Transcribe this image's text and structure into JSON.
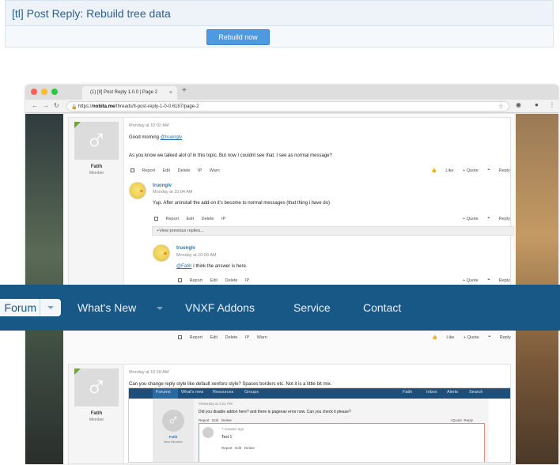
{
  "admin": {
    "title": "[tl] Post Reply: Rebuild tree data",
    "button": "Rebuild now"
  },
  "browser": {
    "tab_title": "(1) [tl] Post Reply 1.0.0 | Page 2",
    "tab_close": "×",
    "new_tab": "+",
    "url_prefix": "https://",
    "url_host": "nobita.me",
    "url_path": "/threads/tl-post-reply-1-0-0.6187/page-2"
  },
  "post1": {
    "author": "Fatih",
    "role": "Member",
    "date": "Monday at 10:02 AM",
    "line1_pre": "Good morning ",
    "line1_mention": "@truonglv",
    "line2": "As you know we talked alot of in this topic. But now I couldnt see that. I see as normal message?",
    "actions": [
      "Report",
      "Edit",
      "Delete",
      "IP",
      "Warn"
    ],
    "right_actions": [
      "Like",
      "+ Quote",
      "Reply"
    ]
  },
  "reply1": {
    "author": "truonglv",
    "date": "Monday at 10:04 AM",
    "text": "Yup. After uninstall the add-on it's become to normal messages (that thing i have do)",
    "actions": [
      "Report",
      "Edit",
      "Delete",
      "IP"
    ],
    "right_actions": [
      "+ Quote",
      "Reply"
    ]
  },
  "view_previous": "+View previous replies...",
  "reply2": {
    "author": "truonglv",
    "date": "Monday at 10:09 AM",
    "mention": "@Fatih",
    "text": " I think the answer is here.",
    "actions": [
      "Report",
      "Edit",
      "Delete",
      "IP"
    ],
    "right_actions": [
      "+ Quote",
      "Reply"
    ]
  },
  "hidden_row": {
    "actions": [
      "Report",
      "Edit",
      "Delete",
      "IP",
      "Warn"
    ],
    "right_actions": [
      "Like",
      "+ Quote",
      "Reply"
    ]
  },
  "nav": {
    "forum": "Forum",
    "items": [
      "What's New",
      "VNXF Addons",
      "Service",
      "Contact"
    ]
  },
  "post2": {
    "author": "Fatih",
    "role": "Member",
    "date": "Monday at 10:18 AM",
    "text": "Can you change reply style like default xenforo style? Spaces borders etc. Not it is a little bit mix."
  },
  "inner": {
    "nav": [
      "Forums",
      "What's new",
      "Resources",
      "Groups"
    ],
    "nav_right": [
      "Fatih",
      "Inbox",
      "Alerts",
      "Search"
    ],
    "date": "Yesterday at 3:21 PM",
    "text": "Did you disable addon here? and there is pagenav error now. Can you check it please?",
    "actions": [
      "Report",
      "Edit",
      "Delete"
    ],
    "right_actions": [
      "+Quote",
      "Reply"
    ],
    "author": "Fatih",
    "role": "New Member",
    "reply_date": "7 minutes ago",
    "reply_text": "Test 1",
    "reply_actions": [
      "Report",
      "Edit",
      "Delete"
    ]
  }
}
